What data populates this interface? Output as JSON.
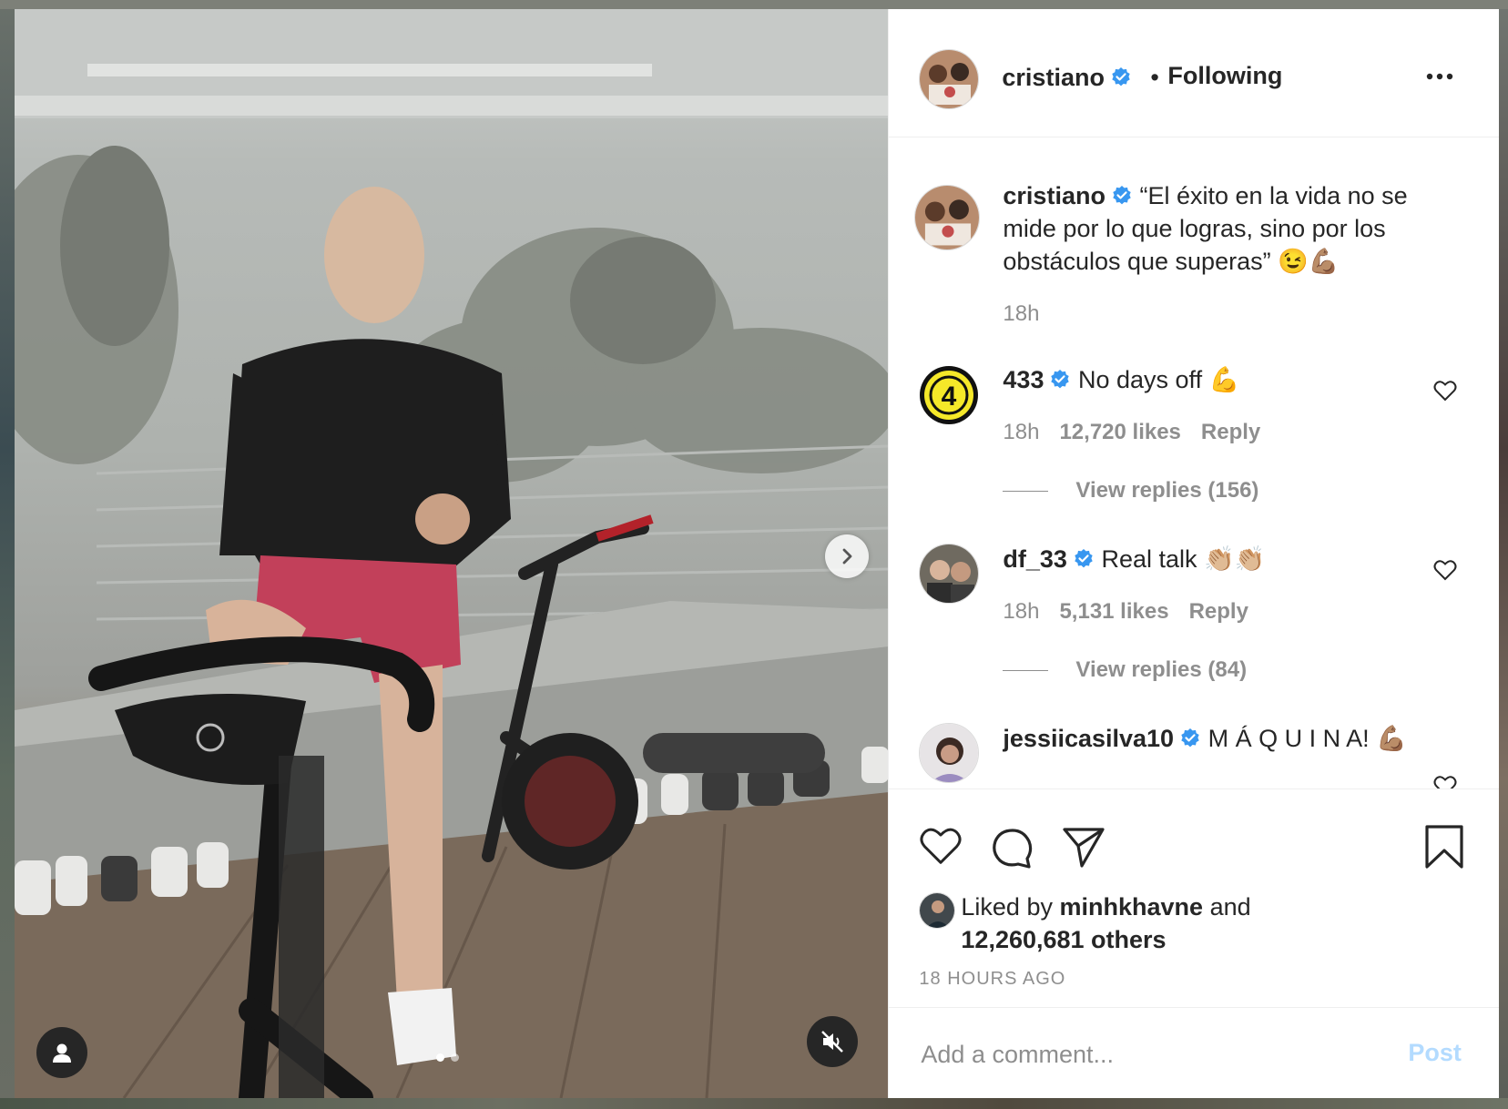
{
  "post": {
    "author": "cristiano",
    "follow_status": "Following",
    "separator": "•",
    "caption": "“El éxito en la vida no se mide por lo que logras, sino por los obstáculos que superas” 😉💪🏽",
    "caption_age": "18h",
    "slide_count": 2,
    "active_slide": 1
  },
  "comments": [
    {
      "username": "433",
      "text": "No days off 💪",
      "age": "18h",
      "likes": "12,720 likes",
      "reply_label": "Reply",
      "view_replies": "View replies (156)"
    },
    {
      "username": "df_33",
      "text": "Real talk 👏🏼👏🏼",
      "age": "18h",
      "likes": "5,131 likes",
      "reply_label": "Reply",
      "view_replies": "View replies (84)"
    },
    {
      "username": "jessiicasilva10",
      "text": "M Á Q U I N A! 💪🏽"
    }
  ],
  "likes": {
    "prefix": "Liked by",
    "first_user": "minhkhavne",
    "joiner": "and",
    "others": "12,260,681 others"
  },
  "timestamp": "18 HOURS AGO",
  "add_comment": {
    "placeholder": "Add a comment...",
    "post_label": "Post"
  },
  "icons": {
    "more": "more-horizontal-icon",
    "like": "heart-icon",
    "comment": "comment-bubble-icon",
    "share": "paper-plane-icon",
    "save": "bookmark-icon",
    "tag": "user-tag-icon",
    "mute": "speaker-muted-icon",
    "next": "chevron-right-icon",
    "verified": "verified-badge-icon"
  },
  "colors": {
    "text_primary": "#262626",
    "text_secondary": "#8e8e8e",
    "verified_blue": "#3897f0",
    "post_disabled": "#b3dbff",
    "border": "#efefef"
  }
}
